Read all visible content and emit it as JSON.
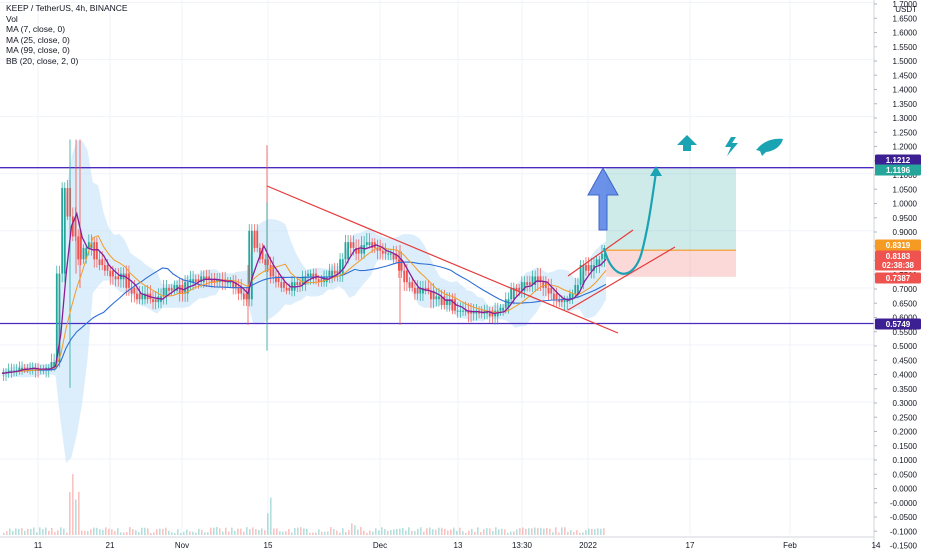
{
  "legend": {
    "symbol": "KEEP / TetherUS, 4h, BINANCE",
    "vol": "Vol",
    "ma7": "MA (7, close, 0)",
    "ma25": "MA (25, close, 0)",
    "ma99": "MA (99, close, 0)",
    "bb": "BB (20, close, 2, 0)"
  },
  "colors": {
    "up": "#26a69a",
    "down": "#ef5350",
    "ma7": "#8a1d98",
    "ma25": "#f59a23",
    "ma99": "#2f6fd6",
    "bb_fill": "#bfe0f7",
    "hline": "#4b2bbf",
    "trend": "#e63a3a",
    "teal": "#19a3b3"
  },
  "chart_data": {
    "type": "candlestick",
    "axis": {
      "currency": "USDT",
      "y_ticks": [
        "1.7000",
        "1.6500",
        "1.6000",
        "1.5500",
        "1.5000",
        "1.4500",
        "1.4000",
        "1.3500",
        "1.3000",
        "1.2500",
        "1.2000",
        "1.1500",
        "1.1000",
        "1.0500",
        "1.0000",
        "0.9500",
        "0.9000",
        "0.8500",
        "0.8000",
        "0.7500",
        "0.7000",
        "0.6500",
        "0.6000",
        "0.5500",
        "0.5000",
        "0.4500",
        "0.4000",
        "0.3500",
        "0.3000",
        "0.2500",
        "0.2000",
        "0.1500",
        "0.1000",
        "0.0500",
        "0.0000",
        "-0.0000",
        "-0.0500",
        "-0.1000",
        "-0.1500"
      ],
      "x_ticks": [
        "11",
        "21",
        "Nov",
        "15",
        "Dec",
        "13",
        "13:30",
        "2022",
        "17",
        "Feb",
        "14"
      ]
    },
    "price_badges": [
      {
        "label": "1.1212",
        "value": 1.1212,
        "color": "#3d1f94"
      },
      {
        "label": "1.1196",
        "value": 1.1196,
        "color": "#26a69a"
      },
      {
        "label": "0.8319",
        "value": 0.8319,
        "color": "#f59a23"
      },
      {
        "label": "0.8183",
        "value": 0.8183,
        "color": "#ef5350"
      },
      {
        "label": "02:38:38",
        "value": 0.798,
        "color": "#ef5350"
      },
      {
        "label": "0.7387",
        "value": 0.7387,
        "color": "#ef5350"
      },
      {
        "label": "0.5749",
        "value": 0.5749,
        "color": "#3d1f94"
      }
    ],
    "horizontal_lines": [
      1.1212,
      0.5749
    ],
    "position": {
      "entry": 0.8319,
      "target": 1.1196,
      "stop": 0.7387
    },
    "price_series": [
      0.4,
      0.405,
      0.41,
      0.41,
      0.42,
      0.415,
      0.42,
      0.41,
      0.415,
      0.42,
      0.44,
      0.75,
      1.05,
      0.95,
      0.88,
      0.8,
      0.84,
      0.86,
      0.8,
      0.78,
      0.76,
      0.74,
      0.73,
      0.75,
      0.7,
      0.68,
      0.66,
      0.68,
      0.66,
      0.65,
      0.67,
      0.7,
      0.69,
      0.71,
      0.68,
      0.72,
      0.73,
      0.72,
      0.74,
      0.73,
      0.72,
      0.73,
      0.72,
      0.72,
      0.7,
      0.68,
      0.66,
      0.9,
      0.84,
      0.8,
      0.78,
      0.74,
      0.72,
      0.7,
      0.69,
      0.72,
      0.71,
      0.74,
      0.75,
      0.73,
      0.72,
      0.74,
      0.76,
      0.75,
      0.8,
      0.86,
      0.84,
      0.82,
      0.85,
      0.86,
      0.84,
      0.83,
      0.82,
      0.82,
      0.8,
      0.76,
      0.72,
      0.7,
      0.68,
      0.7,
      0.69,
      0.66,
      0.67,
      0.64,
      0.66,
      0.62,
      0.62,
      0.62,
      0.61,
      0.62,
      0.61,
      0.62,
      0.6,
      0.62,
      0.63,
      0.66,
      0.7,
      0.69,
      0.72,
      0.71,
      0.74,
      0.72,
      0.7,
      0.68,
      0.66,
      0.65,
      0.66,
      0.68,
      0.71,
      0.78,
      0.76,
      0.78,
      0.8,
      0.82
    ]
  }
}
